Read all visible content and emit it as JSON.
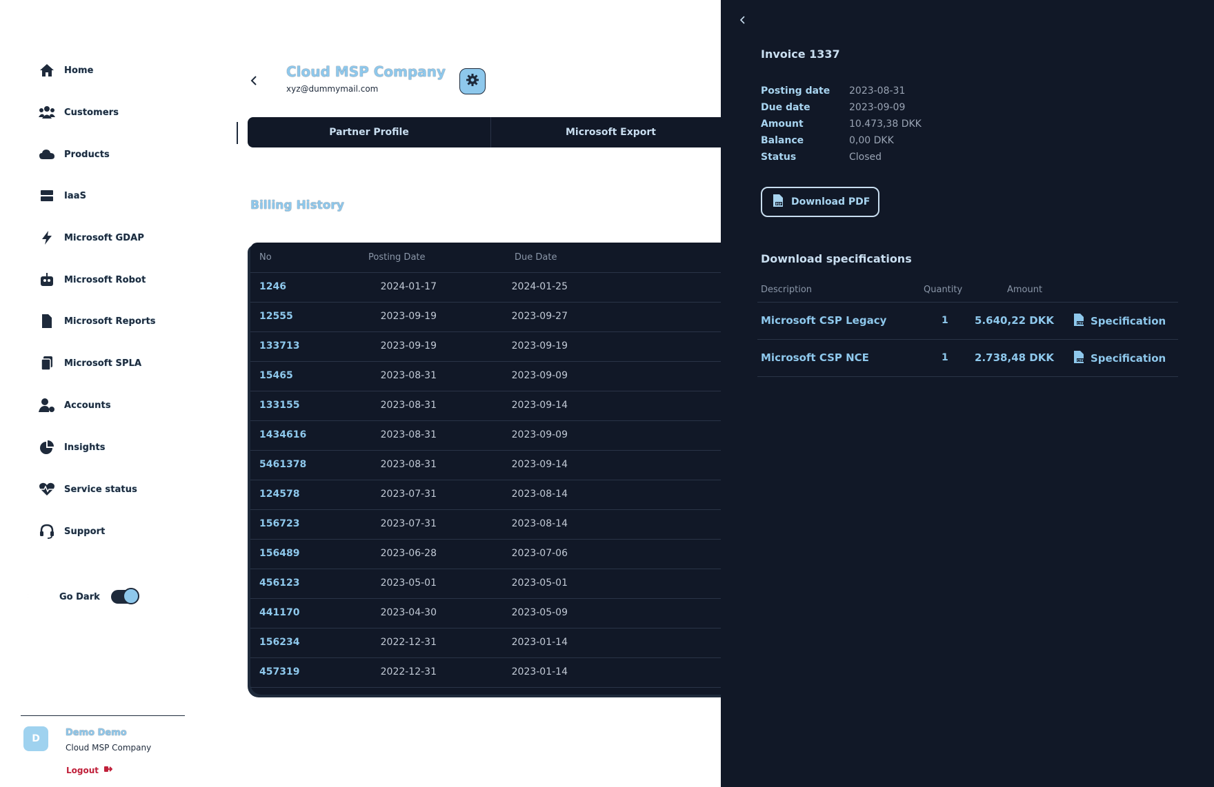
{
  "sidebar": {
    "items": [
      {
        "label": "Home",
        "icon": "home-icon"
      },
      {
        "label": "Customers",
        "icon": "users-icon"
      },
      {
        "label": "Products",
        "icon": "cloud-icon"
      },
      {
        "label": "IaaS",
        "icon": "server-icon"
      },
      {
        "label": "Microsoft GDAP",
        "icon": "bolt-icon"
      },
      {
        "label": "Microsoft Robot",
        "icon": "robot-icon"
      },
      {
        "label": "Microsoft Reports",
        "icon": "document-icon"
      },
      {
        "label": "Microsoft SPLA",
        "icon": "copy-icon"
      },
      {
        "label": "Accounts",
        "icon": "user-gear-icon"
      },
      {
        "label": "Insights",
        "icon": "pie-chart-icon"
      },
      {
        "label": "Service status",
        "icon": "heart-pulse-icon"
      },
      {
        "label": "Support",
        "icon": "headset-icon"
      }
    ],
    "dark_mode_label": "Go Dark",
    "dark_mode_on": true,
    "user": {
      "initial": "D",
      "name": "Demo Demo",
      "company": "Cloud MSP Company"
    },
    "logout_label": "Logout"
  },
  "header": {
    "company_name": "Cloud MSP Company",
    "email": "xyz@dummymail.com"
  },
  "tabs": [
    "Partner Profile",
    "Microsoft Export"
  ],
  "billing": {
    "title": "Billing History",
    "columns": [
      "No",
      "Posting Date",
      "Due Date"
    ],
    "rows": [
      {
        "no": "1246",
        "posting": "2024-01-17",
        "due": "2024-01-25"
      },
      {
        "no": "12555",
        "posting": "2023-09-19",
        "due": "2023-09-27"
      },
      {
        "no": "133713",
        "posting": "2023-09-19",
        "due": "2023-09-19"
      },
      {
        "no": "15465",
        "posting": "2023-08-31",
        "due": "2023-09-09"
      },
      {
        "no": "133155",
        "posting": "2023-08-31",
        "due": "2023-09-14"
      },
      {
        "no": "1434616",
        "posting": "2023-08-31",
        "due": "2023-09-09"
      },
      {
        "no": "5461378",
        "posting": "2023-08-31",
        "due": "2023-09-14"
      },
      {
        "no": "124578",
        "posting": "2023-07-31",
        "due": "2023-08-14"
      },
      {
        "no": "156723",
        "posting": "2023-07-31",
        "due": "2023-08-14"
      },
      {
        "no": "156489",
        "posting": "2023-06-28",
        "due": "2023-07-06"
      },
      {
        "no": "456123",
        "posting": "2023-05-01",
        "due": "2023-05-01"
      },
      {
        "no": "441170",
        "posting": "2023-04-30",
        "due": "2023-05-09"
      },
      {
        "no": "156234",
        "posting": "2022-12-31",
        "due": "2023-01-14"
      },
      {
        "no": "457319",
        "posting": "2022-12-31",
        "due": "2023-01-14"
      }
    ]
  },
  "invoice_panel": {
    "title": "Invoice 1337",
    "fields": [
      {
        "label": "Posting date",
        "value": "2023-08-31"
      },
      {
        "label": "Due date",
        "value": "2023-09-09"
      },
      {
        "label": "Amount",
        "value": "10.473,38 DKK"
      },
      {
        "label": "Balance",
        "value": "0,00 DKK"
      },
      {
        "label": "Status",
        "value": "Closed"
      }
    ],
    "download_pdf_label": "Download PDF",
    "specs_title": "Download specifications",
    "spec_columns": [
      "Description",
      "Quantity",
      "Amount"
    ],
    "specs": [
      {
        "description": "Microsoft CSP Legacy",
        "quantity": "1",
        "amount": "5.640,22 DKK",
        "link": "Specification"
      },
      {
        "description": "Microsoft CSP NCE",
        "quantity": "1",
        "amount": "2.738,48 DKK",
        "link": "Specification"
      }
    ]
  },
  "colors": {
    "accent": "#8ec8ec",
    "dark": "#111827",
    "logout": "#c0203a"
  }
}
